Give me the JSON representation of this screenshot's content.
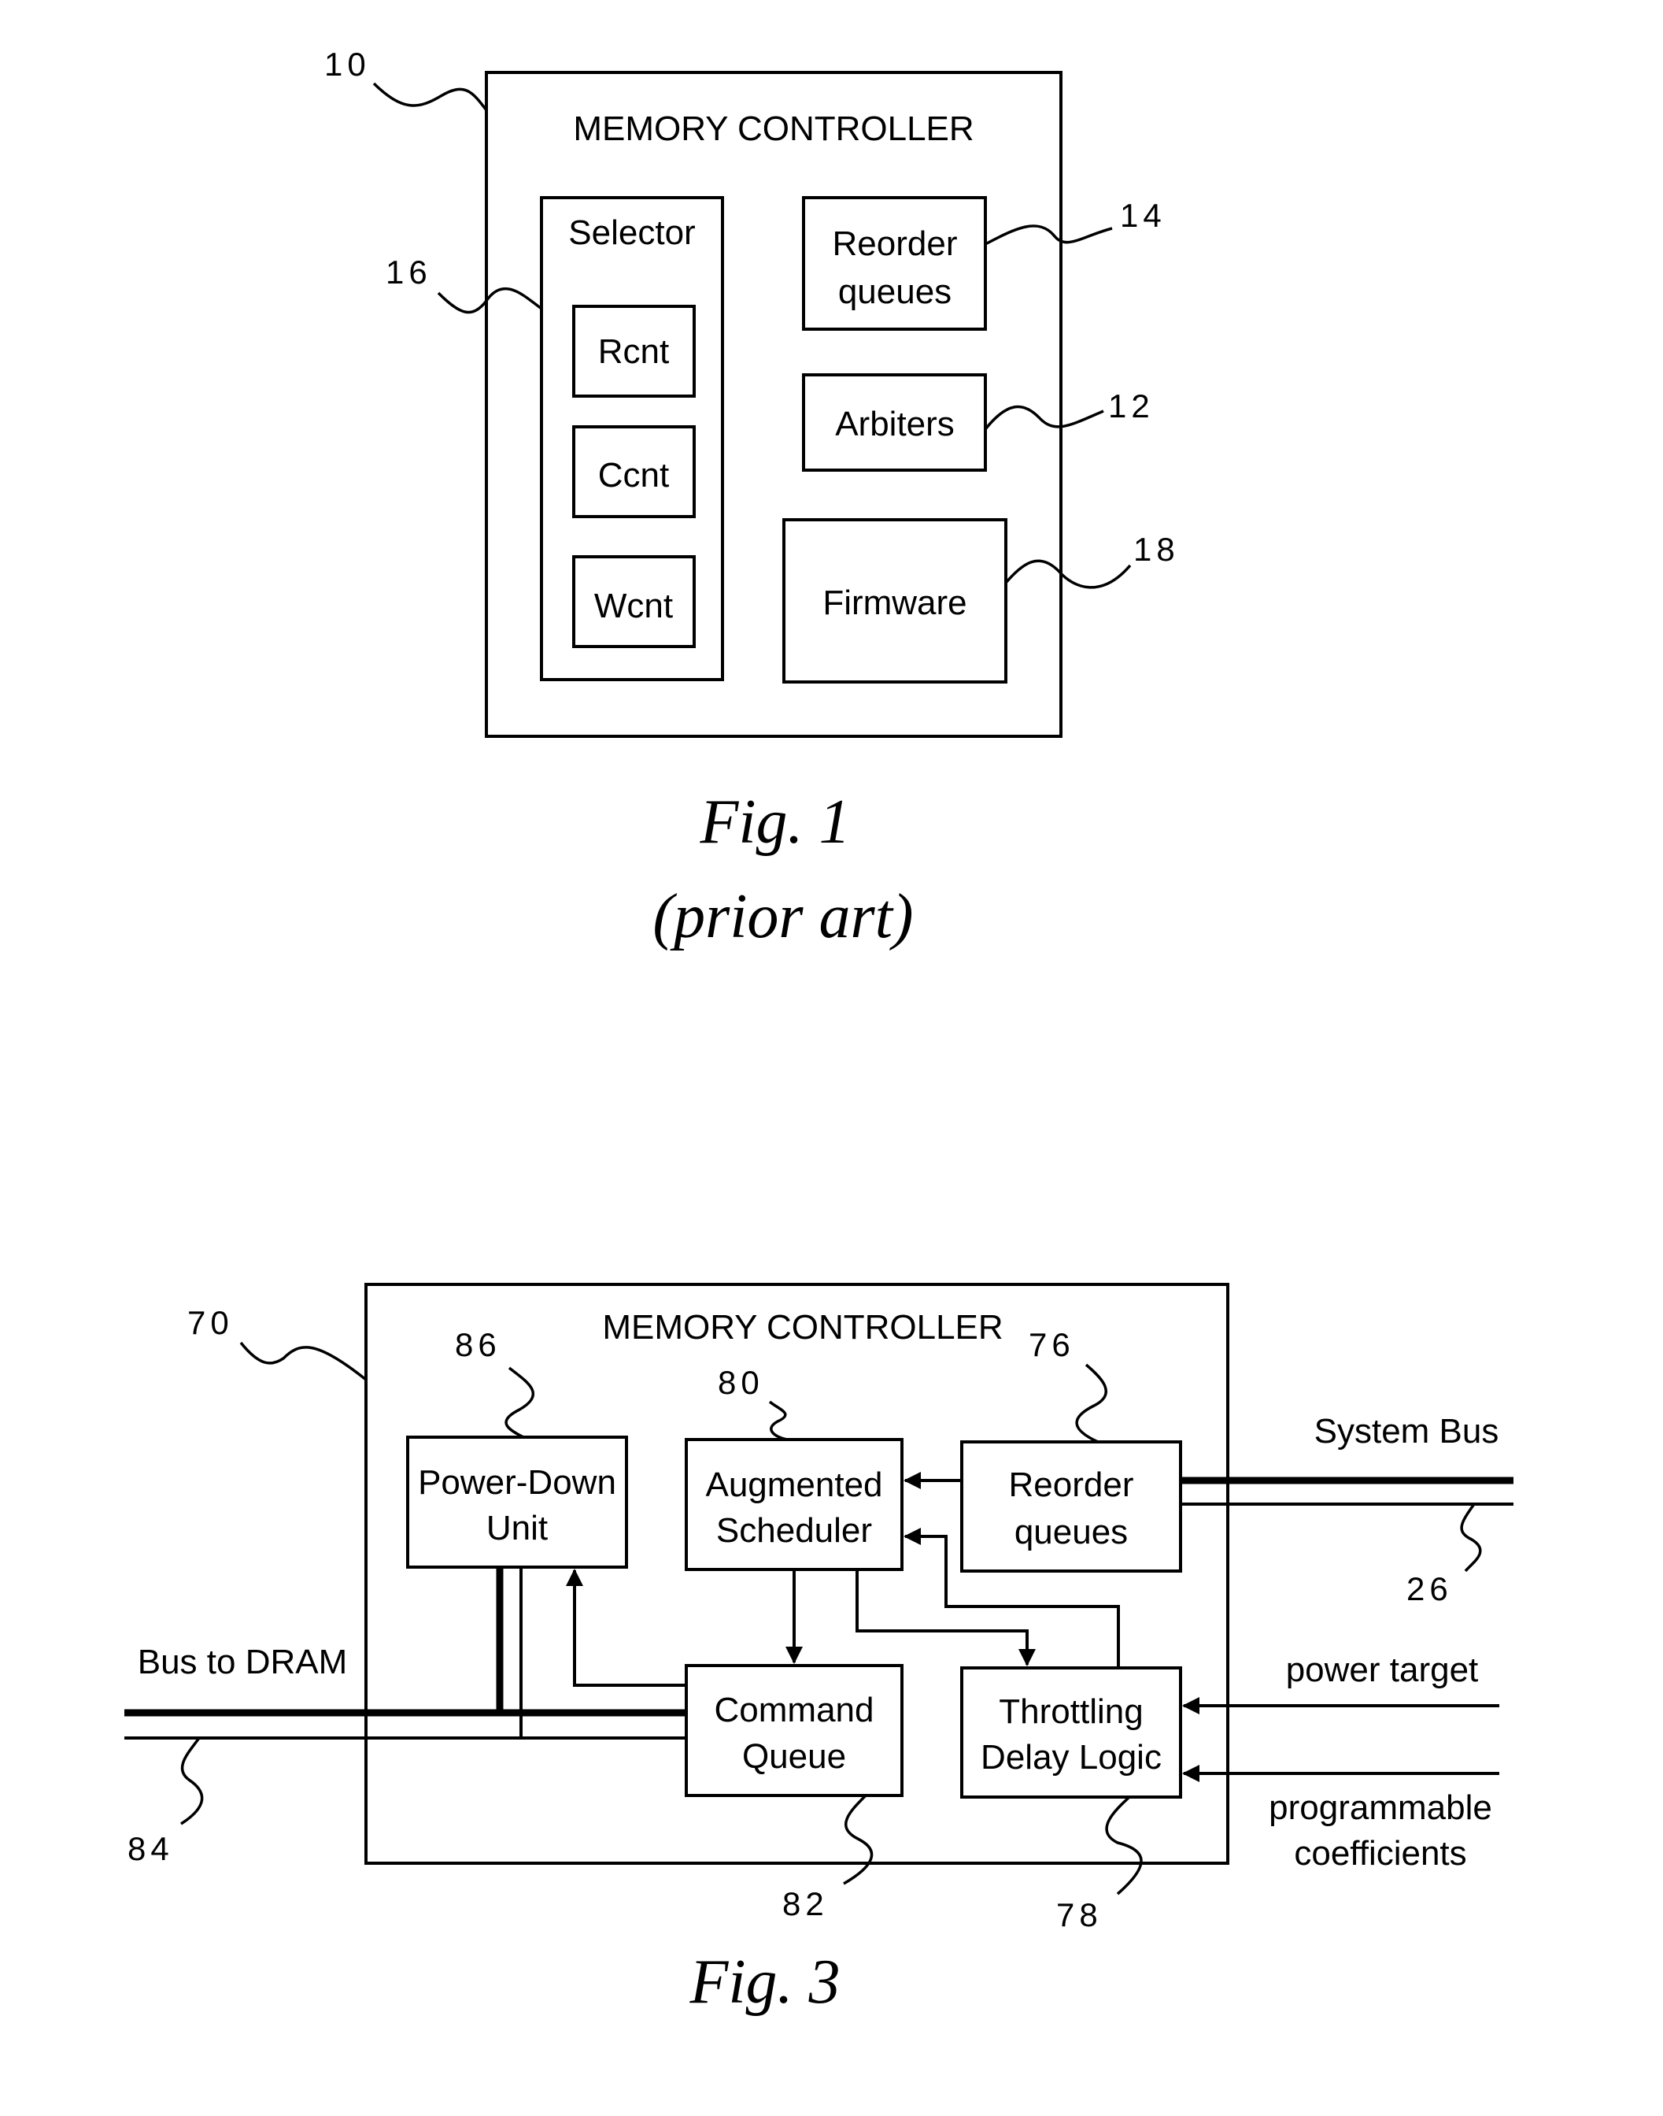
{
  "fig1": {
    "title": "MEMORY CONTROLLER",
    "selector_label": "Selector",
    "counters": [
      "Rcnt",
      "Ccnt",
      "Wcnt"
    ],
    "reorder": [
      "Reorder",
      "queues"
    ],
    "arbiters": "Arbiters",
    "firmware": "Firmware",
    "refs": {
      "controller": "10",
      "selector": "16",
      "reorder": "14",
      "arbiters": "12",
      "firmware": "18"
    },
    "caption": "Fig. 1",
    "subcaption": "(prior art)"
  },
  "fig3": {
    "title": "MEMORY CONTROLLER",
    "power_down": [
      "Power-Down",
      "Unit"
    ],
    "scheduler": [
      "Augmented",
      "Scheduler"
    ],
    "reorder": [
      "Reorder",
      "queues"
    ],
    "command_queue": [
      "Command",
      "Queue"
    ],
    "throttling": [
      "Throttling",
      "Delay Logic"
    ],
    "system_bus": "System Bus",
    "bus_to_dram": "Bus to DRAM",
    "power_target": "power target",
    "coefficients": [
      "programmable",
      "coefficients"
    ],
    "refs": {
      "controller": "70",
      "power_down": "86",
      "scheduler": "80",
      "reorder": "76",
      "system_bus": "26",
      "dram_bus": "84",
      "command_queue": "82",
      "throttling": "78"
    },
    "caption": "Fig. 3"
  }
}
